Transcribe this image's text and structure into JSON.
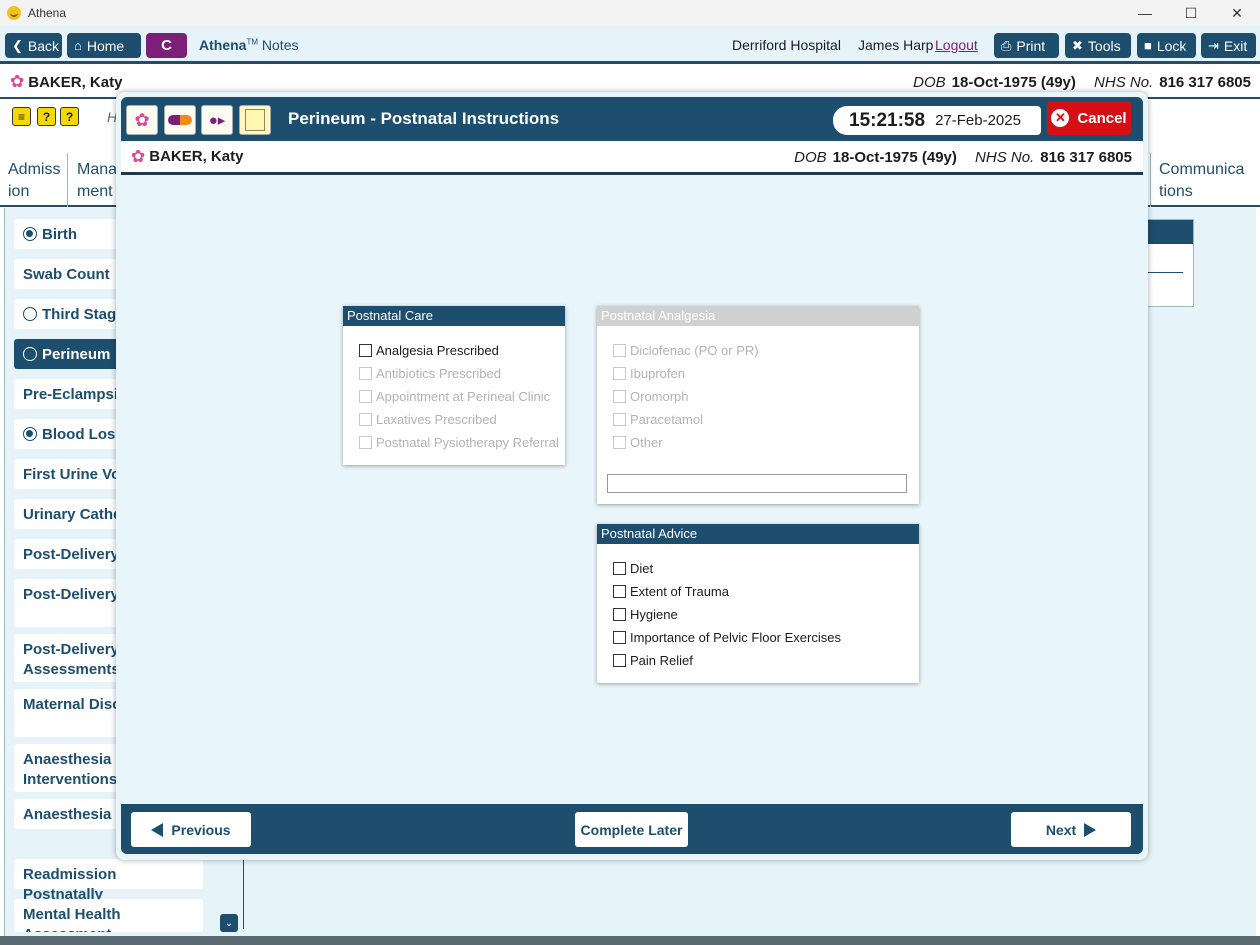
{
  "window": {
    "title": "Athena",
    "minimize": "—",
    "maximize": "☐",
    "close": "✕"
  },
  "toolbar": {
    "back": "Back",
    "home": "Home",
    "c_button": "C",
    "brand_name": "Athena",
    "brand_tm": "TM",
    "brand_suffix": "Notes",
    "hospital": "Derriford Hospital",
    "user": "James Harp",
    "logout": "Logout",
    "print": "Print",
    "tools": "Tools",
    "lock": "Lock",
    "exit": "Exit"
  },
  "patient": {
    "name": "BAKER, Katy",
    "dob_label": "DOB",
    "dob": "18-Oct-1975 (49y)",
    "nhs_label": "NHS No.",
    "nhs": "816 317 6805"
  },
  "background": {
    "help_icons": [
      "≡",
      "?",
      "?"
    ],
    "header_partial": "H",
    "tabs": [
      {
        "line1": "Admiss",
        "line2": "ion"
      },
      {
        "line1": "Mana",
        "line2": "ment"
      },
      {
        "line1": "Communica",
        "line2": "tions"
      }
    ],
    "sidebar": [
      {
        "label": "Birth",
        "radio": "on"
      },
      {
        "label": "Swab Count",
        "radio": "none"
      },
      {
        "label": "Third Stage",
        "radio": "off"
      },
      {
        "label": "Perineum",
        "radio": "off",
        "active": true
      },
      {
        "label": "Pre-Eclampsia",
        "radio": "none"
      },
      {
        "label": "Blood Loss",
        "radio": "on"
      },
      {
        "label": "First Urine Voi",
        "radio": "none"
      },
      {
        "label": "Urinary Cathe",
        "radio": "none"
      },
      {
        "label": "Post-Delivery",
        "radio": "none"
      },
      {
        "label": "Post-Delivery Notes",
        "radio": "none"
      },
      {
        "label": "Post-Delivery Assessments",
        "radio": "none"
      },
      {
        "label": "Maternal Disc Summary",
        "radio": "none"
      },
      {
        "label": "Anaesthesia Interventions",
        "radio": "none"
      },
      {
        "label": "Anaesthesia F",
        "radio": "none"
      },
      {
        "label": "Readmission Postnatally",
        "radio": "none"
      },
      {
        "label": "Mental Health Assessment",
        "radio": "none"
      }
    ],
    "scroll_icon": "⌄"
  },
  "modal": {
    "title": "Perineum - Postnatal Instructions",
    "time": "15:21:58",
    "date": "27-Feb-2025",
    "cancel": "Cancel",
    "postnatal_care": {
      "header": "Postnatal Care",
      "items": [
        {
          "label": "Analgesia Prescribed",
          "enabled": true
        },
        {
          "label": "Antibiotics Prescribed",
          "enabled": false
        },
        {
          "label": "Appointment at Perineal Clinic",
          "enabled": false
        },
        {
          "label": "Laxatives Prescribed",
          "enabled": false
        },
        {
          "label": "Postnatal Pysiotherapy Referral",
          "enabled": false
        }
      ]
    },
    "postnatal_analgesia": {
      "header": "Postnatal Analgesia",
      "items": [
        {
          "label": "Diclofenac (PO or PR)",
          "enabled": false
        },
        {
          "label": "Ibuprofen",
          "enabled": false
        },
        {
          "label": "Oromorph",
          "enabled": false
        },
        {
          "label": "Paracetamol",
          "enabled": false
        },
        {
          "label": "Other",
          "enabled": false
        }
      ],
      "other_value": ""
    },
    "postnatal_advice": {
      "header": "Postnatal Advice",
      "items": [
        {
          "label": "Diet",
          "enabled": true
        },
        {
          "label": "Extent of Trauma",
          "enabled": true
        },
        {
          "label": "Hygiene",
          "enabled": true
        },
        {
          "label": "Importance of Pelvic Floor Exercises",
          "enabled": true
        },
        {
          "label": "Pain Relief",
          "enabled": true
        }
      ]
    },
    "footer": {
      "previous": "Previous",
      "complete_later": "Complete Later",
      "next": "Next"
    }
  },
  "colors": {
    "primary": "#1d4e6e",
    "accent": "#7b1f79",
    "cancel": "#d50f14",
    "background": "#e6f4f9"
  }
}
